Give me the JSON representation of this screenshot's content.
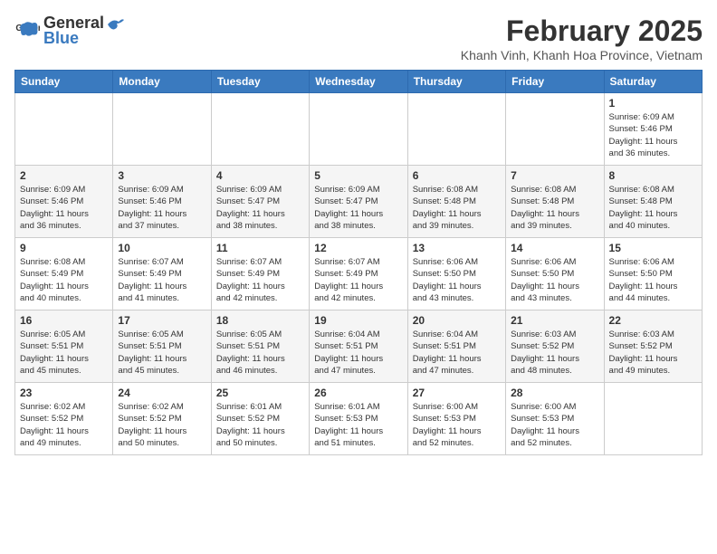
{
  "header": {
    "logo_general": "General",
    "logo_blue": "Blue",
    "month_title": "February 2025",
    "location": "Khanh Vinh, Khanh Hoa Province, Vietnam"
  },
  "weekdays": [
    "Sunday",
    "Monday",
    "Tuesday",
    "Wednesday",
    "Thursday",
    "Friday",
    "Saturday"
  ],
  "weeks": [
    [
      {
        "day": "",
        "info": ""
      },
      {
        "day": "",
        "info": ""
      },
      {
        "day": "",
        "info": ""
      },
      {
        "day": "",
        "info": ""
      },
      {
        "day": "",
        "info": ""
      },
      {
        "day": "",
        "info": ""
      },
      {
        "day": "1",
        "info": "Sunrise: 6:09 AM\nSunset: 5:46 PM\nDaylight: 11 hours\nand 36 minutes."
      }
    ],
    [
      {
        "day": "2",
        "info": "Sunrise: 6:09 AM\nSunset: 5:46 PM\nDaylight: 11 hours\nand 36 minutes."
      },
      {
        "day": "3",
        "info": "Sunrise: 6:09 AM\nSunset: 5:46 PM\nDaylight: 11 hours\nand 37 minutes."
      },
      {
        "day": "4",
        "info": "Sunrise: 6:09 AM\nSunset: 5:47 PM\nDaylight: 11 hours\nand 38 minutes."
      },
      {
        "day": "5",
        "info": "Sunrise: 6:09 AM\nSunset: 5:47 PM\nDaylight: 11 hours\nand 38 minutes."
      },
      {
        "day": "6",
        "info": "Sunrise: 6:08 AM\nSunset: 5:48 PM\nDaylight: 11 hours\nand 39 minutes."
      },
      {
        "day": "7",
        "info": "Sunrise: 6:08 AM\nSunset: 5:48 PM\nDaylight: 11 hours\nand 39 minutes."
      },
      {
        "day": "8",
        "info": "Sunrise: 6:08 AM\nSunset: 5:48 PM\nDaylight: 11 hours\nand 40 minutes."
      }
    ],
    [
      {
        "day": "9",
        "info": "Sunrise: 6:08 AM\nSunset: 5:49 PM\nDaylight: 11 hours\nand 40 minutes."
      },
      {
        "day": "10",
        "info": "Sunrise: 6:07 AM\nSunset: 5:49 PM\nDaylight: 11 hours\nand 41 minutes."
      },
      {
        "day": "11",
        "info": "Sunrise: 6:07 AM\nSunset: 5:49 PM\nDaylight: 11 hours\nand 42 minutes."
      },
      {
        "day": "12",
        "info": "Sunrise: 6:07 AM\nSunset: 5:49 PM\nDaylight: 11 hours\nand 42 minutes."
      },
      {
        "day": "13",
        "info": "Sunrise: 6:06 AM\nSunset: 5:50 PM\nDaylight: 11 hours\nand 43 minutes."
      },
      {
        "day": "14",
        "info": "Sunrise: 6:06 AM\nSunset: 5:50 PM\nDaylight: 11 hours\nand 43 minutes."
      },
      {
        "day": "15",
        "info": "Sunrise: 6:06 AM\nSunset: 5:50 PM\nDaylight: 11 hours\nand 44 minutes."
      }
    ],
    [
      {
        "day": "16",
        "info": "Sunrise: 6:05 AM\nSunset: 5:51 PM\nDaylight: 11 hours\nand 45 minutes."
      },
      {
        "day": "17",
        "info": "Sunrise: 6:05 AM\nSunset: 5:51 PM\nDaylight: 11 hours\nand 45 minutes."
      },
      {
        "day": "18",
        "info": "Sunrise: 6:05 AM\nSunset: 5:51 PM\nDaylight: 11 hours\nand 46 minutes."
      },
      {
        "day": "19",
        "info": "Sunrise: 6:04 AM\nSunset: 5:51 PM\nDaylight: 11 hours\nand 47 minutes."
      },
      {
        "day": "20",
        "info": "Sunrise: 6:04 AM\nSunset: 5:51 PM\nDaylight: 11 hours\nand 47 minutes."
      },
      {
        "day": "21",
        "info": "Sunrise: 6:03 AM\nSunset: 5:52 PM\nDaylight: 11 hours\nand 48 minutes."
      },
      {
        "day": "22",
        "info": "Sunrise: 6:03 AM\nSunset: 5:52 PM\nDaylight: 11 hours\nand 49 minutes."
      }
    ],
    [
      {
        "day": "23",
        "info": "Sunrise: 6:02 AM\nSunset: 5:52 PM\nDaylight: 11 hours\nand 49 minutes."
      },
      {
        "day": "24",
        "info": "Sunrise: 6:02 AM\nSunset: 5:52 PM\nDaylight: 11 hours\nand 50 minutes."
      },
      {
        "day": "25",
        "info": "Sunrise: 6:01 AM\nSunset: 5:52 PM\nDaylight: 11 hours\nand 50 minutes."
      },
      {
        "day": "26",
        "info": "Sunrise: 6:01 AM\nSunset: 5:53 PM\nDaylight: 11 hours\nand 51 minutes."
      },
      {
        "day": "27",
        "info": "Sunrise: 6:00 AM\nSunset: 5:53 PM\nDaylight: 11 hours\nand 52 minutes."
      },
      {
        "day": "28",
        "info": "Sunrise: 6:00 AM\nSunset: 5:53 PM\nDaylight: 11 hours\nand 52 minutes."
      },
      {
        "day": "",
        "info": ""
      }
    ]
  ]
}
